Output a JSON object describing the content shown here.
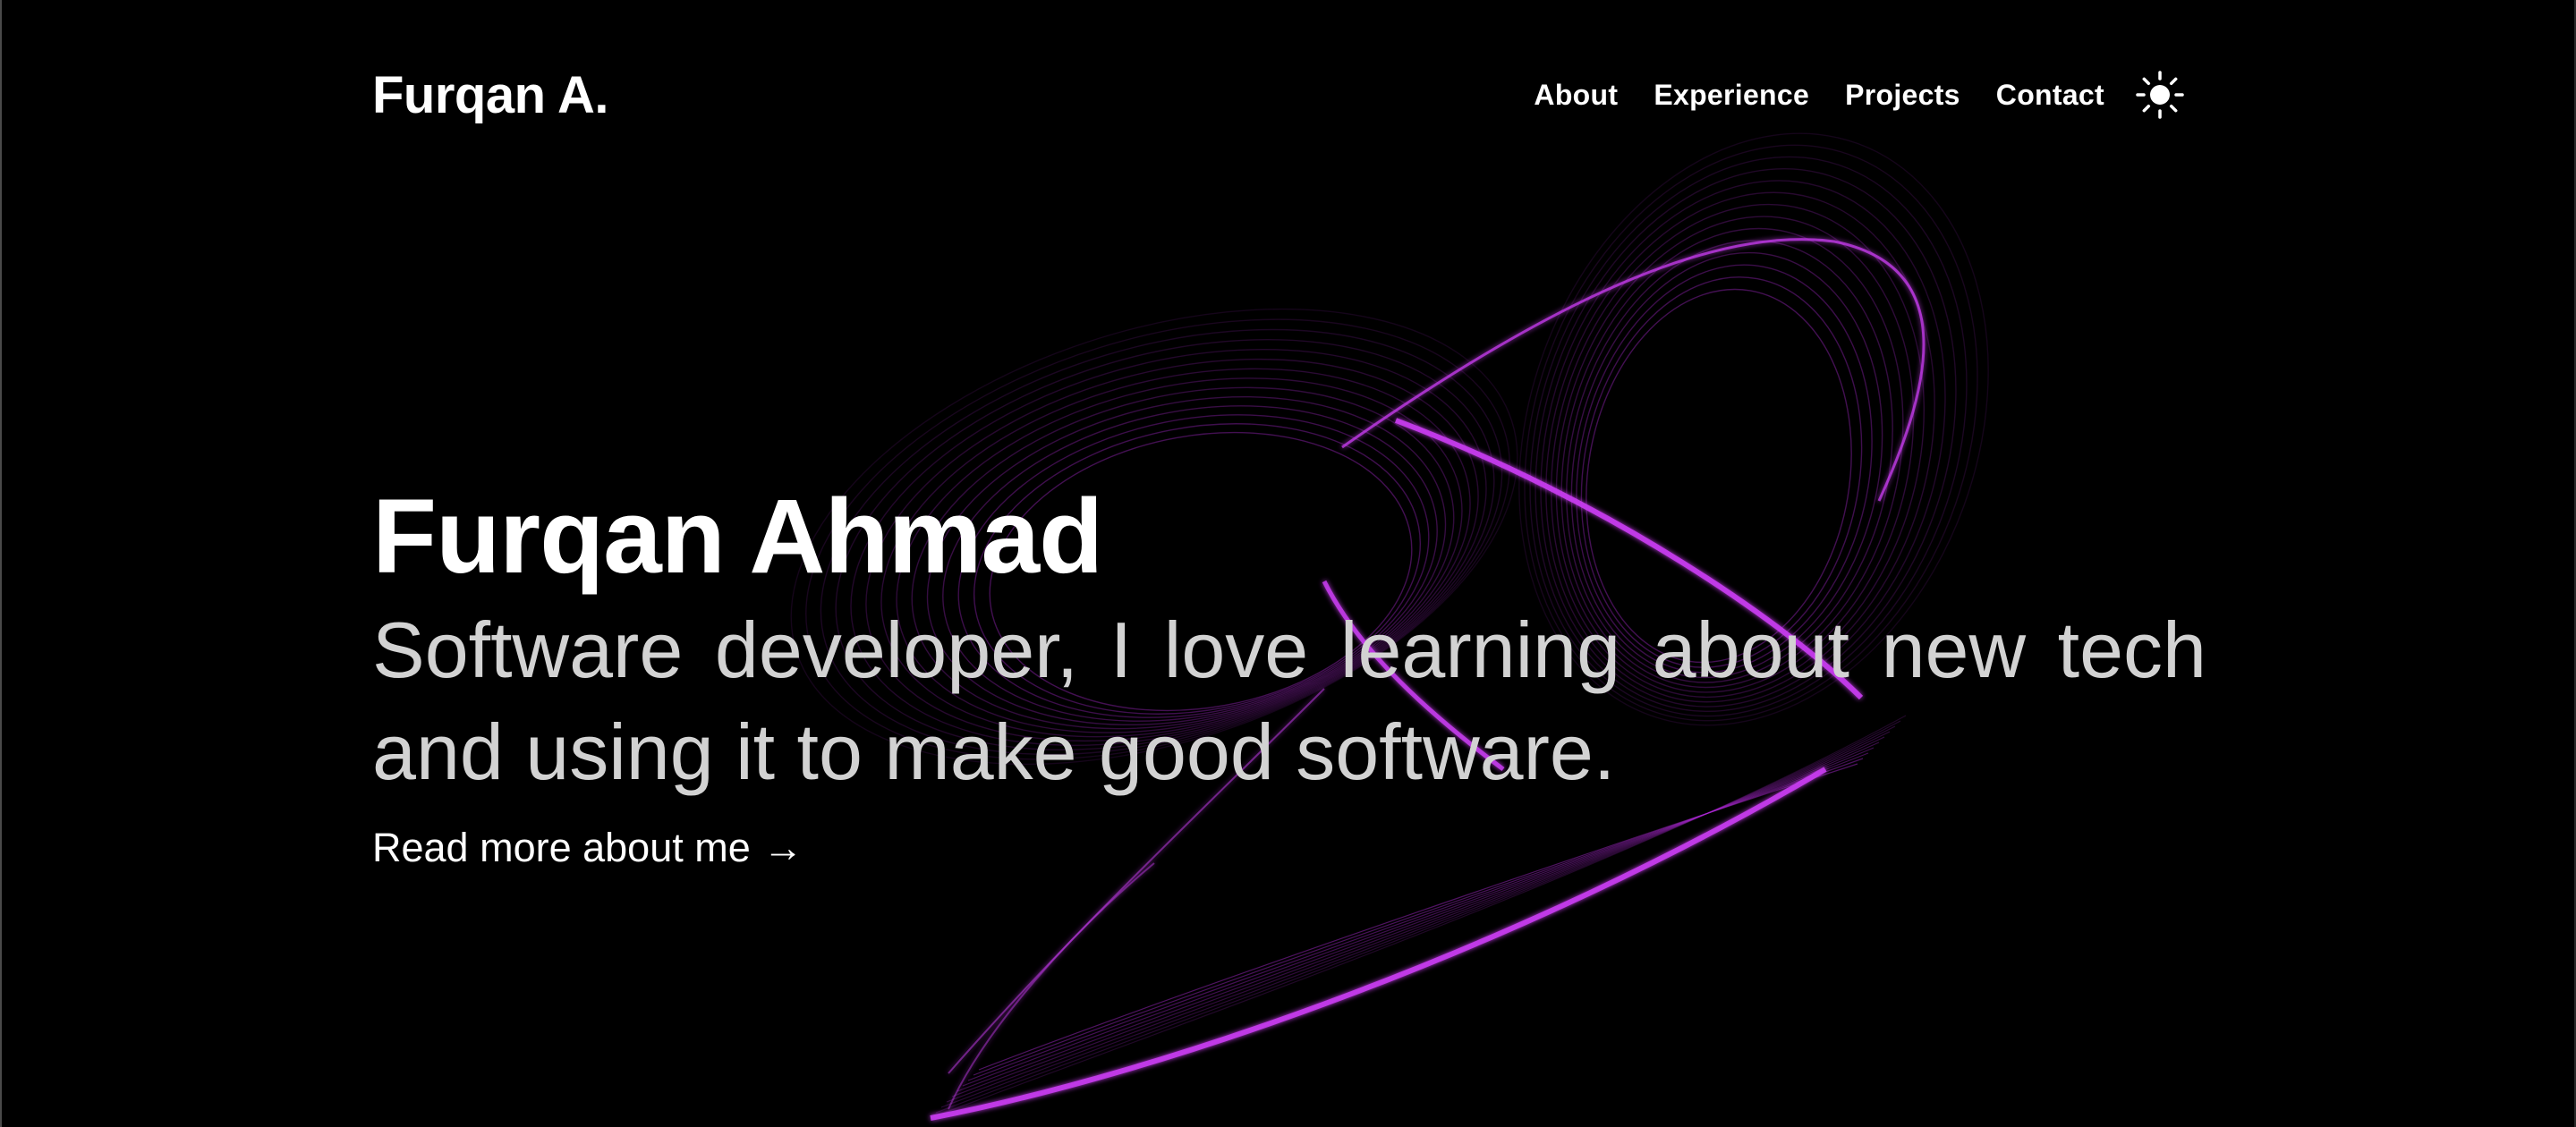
{
  "header": {
    "logo": "Furqan A.",
    "nav": [
      {
        "label": "About"
      },
      {
        "label": "Experience"
      },
      {
        "label": "Projects"
      },
      {
        "label": "Contact"
      }
    ],
    "theme_toggle_icon": "sun-icon"
  },
  "hero": {
    "name": "Furqan Ahmad",
    "tagline": "Software developer, I love learning about new tech and using it to make good software.",
    "cta_label": "Read more about me",
    "cta_arrow": "→"
  },
  "theme": {
    "background": "#000000",
    "text": "#ffffff",
    "tagline_text": "#d2d2d2",
    "accent": "#c030e0"
  }
}
